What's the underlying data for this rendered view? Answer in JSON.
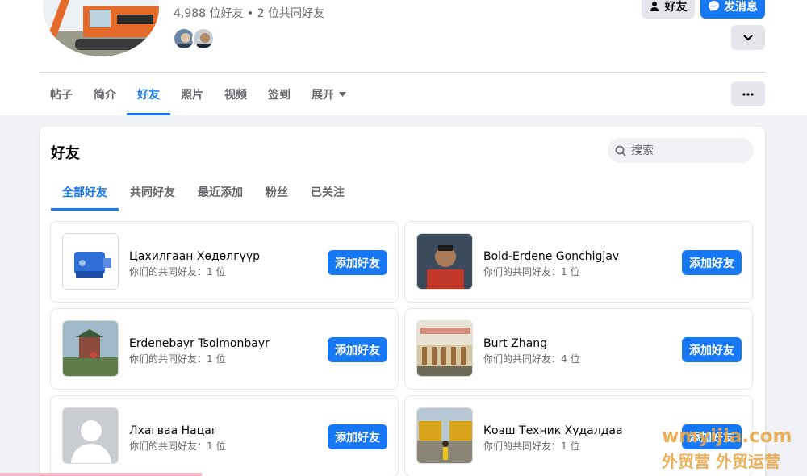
{
  "profile": {
    "friends_summary": "4,988 位好友 • 2 位共同好友",
    "friends_button": "好友",
    "message_button": "发消息"
  },
  "tabs": [
    {
      "label": "帖子"
    },
    {
      "label": "简介"
    },
    {
      "label": "好友"
    },
    {
      "label": "照片"
    },
    {
      "label": "视频"
    },
    {
      "label": "签到"
    },
    {
      "label": "展开"
    }
  ],
  "friends_panel": {
    "title": "好友",
    "search_placeholder": "搜索",
    "subtabs": [
      {
        "label": "全部好友"
      },
      {
        "label": "共同好友"
      },
      {
        "label": "最近添加"
      },
      {
        "label": "粉丝"
      },
      {
        "label": "已关注"
      }
    ],
    "add_label": "添加好友",
    "cards": [
      {
        "name": "Цахилгаан Хөдөлгүүр",
        "mutual": "你们的共同好友：1 位"
      },
      {
        "name": "Bold-Erdene Gonchigjav",
        "mutual": "你们的共同好友：1 位"
      },
      {
        "name": "Erdenebayr Tsolmonbayr",
        "mutual": "你们的共同好友：1 位"
      },
      {
        "name": "Burt Zhang",
        "mutual": "你们的共同好友：4 位"
      },
      {
        "name": "Лхагваа Нацаг",
        "mutual": "你们的共同好友：1 位"
      },
      {
        "name": "Ковш Техник Худалдаа",
        "mutual": "你们的共同好友：1 位"
      }
    ]
  },
  "watermark": {
    "line1": "wmyijia.com",
    "line2": "外贸营 外贸运营"
  },
  "colors": {
    "accent": "#1877f2",
    "secondary_button": "#e4e6eb",
    "background": "#f0f2f5"
  }
}
